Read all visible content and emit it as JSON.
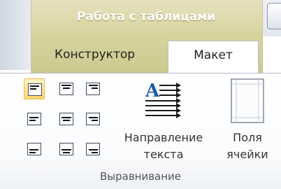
{
  "context_tab_group": {
    "title": "Работа с таблицами"
  },
  "tabs": [
    {
      "label": "Конструктор",
      "active": false
    },
    {
      "label": "Макет",
      "active": true
    }
  ],
  "alignment_buttons": [
    {
      "name": "align-top-left",
      "selected": true
    },
    {
      "name": "align-top-center",
      "selected": false
    },
    {
      "name": "align-top-right",
      "selected": false
    },
    {
      "name": "align-center-left",
      "selected": false
    },
    {
      "name": "align-center-center",
      "selected": false
    },
    {
      "name": "align-center-right",
      "selected": false
    },
    {
      "name": "align-bottom-left",
      "selected": false
    },
    {
      "name": "align-bottom-center",
      "selected": false
    },
    {
      "name": "align-bottom-right",
      "selected": false
    }
  ],
  "text_direction": {
    "line1": "Направление",
    "line2": "текста",
    "icon": "text-direction-icon"
  },
  "cell_margins": {
    "line1": "Поля",
    "line2": "ячейки",
    "icon": "cell-margins-icon"
  },
  "group": {
    "label": "Выравнивание"
  },
  "colors": {
    "context_tab": "#d7d39d",
    "selected_button": "#ffd86e",
    "accent_blue": "#1e5aa8"
  }
}
